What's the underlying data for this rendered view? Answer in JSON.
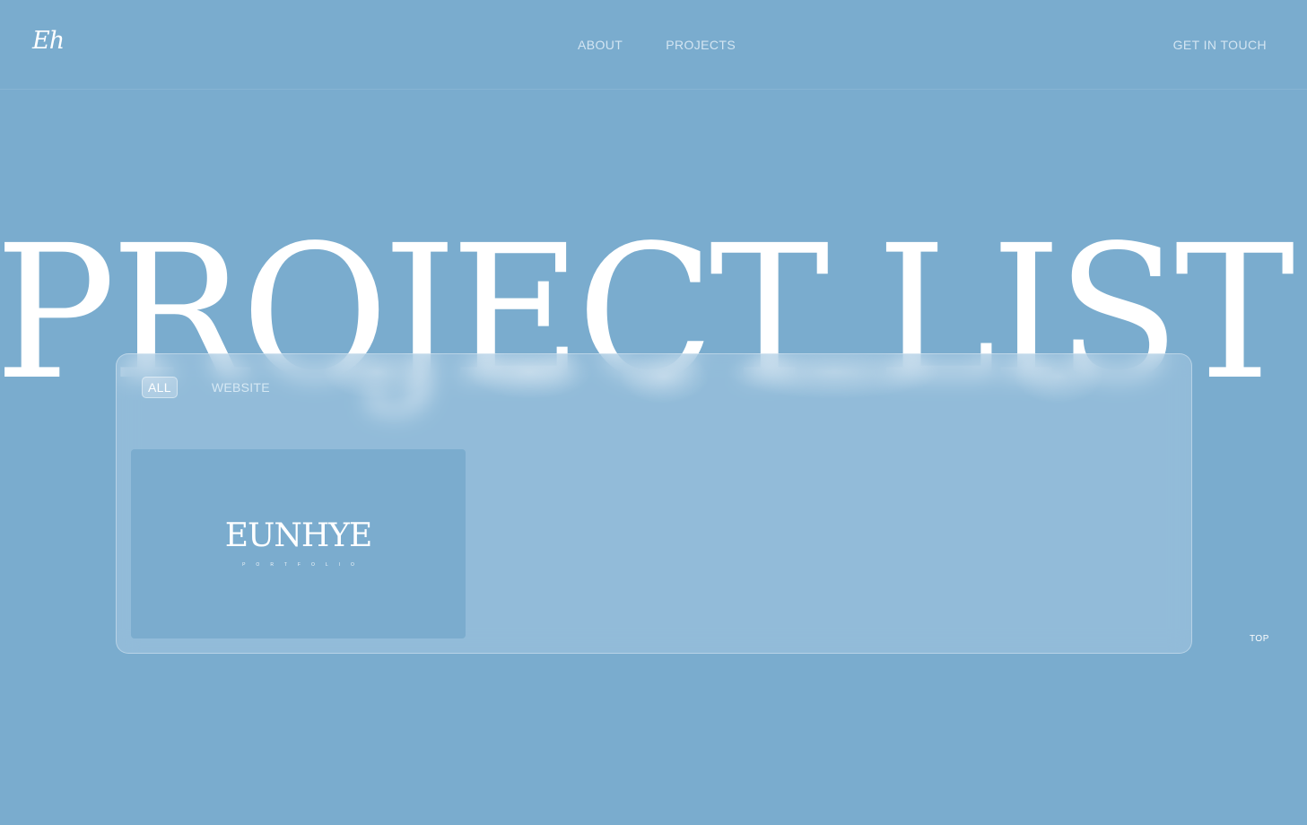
{
  "header": {
    "logo": "Eh",
    "nav": [
      {
        "label": "ABOUT"
      },
      {
        "label": "PROJECTS"
      }
    ],
    "contact_label": "GET IN TOUCH"
  },
  "hero": {
    "title": "PROJECT LIST"
  },
  "panel": {
    "filters": [
      {
        "label": "ALL",
        "active": true
      },
      {
        "label": "WEBSITE",
        "active": false
      }
    ],
    "projects": [
      {
        "brand": "EUNHYE",
        "sub": "PORTFOLIO"
      }
    ]
  },
  "top_button": "TOP",
  "colors": {
    "background": "#7aacce",
    "text": "#ffffff",
    "panel": "#a6c8e1"
  }
}
